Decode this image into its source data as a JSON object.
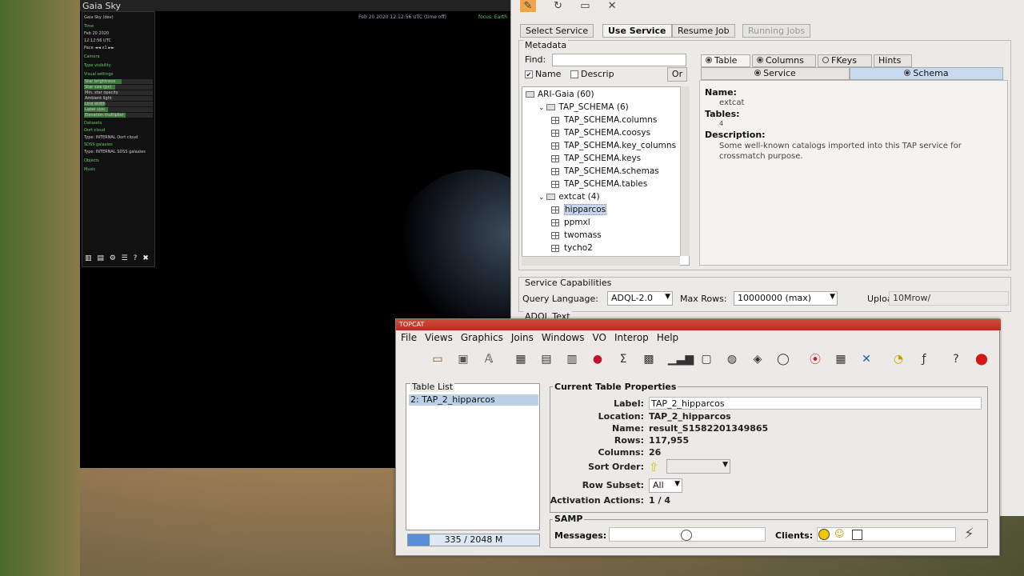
{
  "gaia": {
    "title": "Gaia Sky",
    "clock": "Feb 20 2020 12:12:56 UTC (time off)",
    "focus": "focus: Earth",
    "panel": {
      "header": "Gaia Sky (dev)",
      "time_label": "Time",
      "date": "Feb 20 2020",
      "time": "12:12:56 UTC",
      "pace": "Pace ◄◄ x1 ►►",
      "camera": "Camera",
      "type_visibility": "Type visibility",
      "visual_settings": "Visual settings",
      "sliders": [
        {
          "label": "Star brightness",
          "level": 0.55
        },
        {
          "label": "Star size (px)",
          "level": 0.45
        },
        {
          "label": "Min. star opacity",
          "level": 0.0
        },
        {
          "label": "Ambient light",
          "level": 0.0
        },
        {
          "label": "Line width",
          "level": 0.3
        },
        {
          "label": "Label size",
          "level": 0.35
        },
        {
          "label": "Elevation multiplier",
          "level": 0.6
        }
      ],
      "datasets": "Datasets",
      "ds1_name": "Oort cloud",
      "ds1_info": "Type: INTERNAL  Oort cloud",
      "ds2_name": "SDSS galaxies",
      "ds2_info": "Type: INTERNAL  SDSS galaxies",
      "objects": "Objects",
      "music": "Music"
    }
  },
  "tap": {
    "tabs": [
      "Select Service",
      "Use Service",
      "Resume Job",
      "Running Jobs"
    ],
    "metadata": {
      "legend": "Metadata",
      "find_label": "Find:",
      "name_label": "Name",
      "descrip_label": "Descrip",
      "or_label": "Or",
      "tree": [
        {
          "label": "ARI-Gaia (60)",
          "depth": 0,
          "kind": "root"
        },
        {
          "label": "TAP_SCHEMA (6)",
          "depth": 1,
          "kind": "folder"
        },
        {
          "label": "TAP_SCHEMA.columns",
          "depth": 2,
          "kind": "table"
        },
        {
          "label": "TAP_SCHEMA.coosys",
          "depth": 2,
          "kind": "table"
        },
        {
          "label": "TAP_SCHEMA.key_columns",
          "depth": 2,
          "kind": "table"
        },
        {
          "label": "TAP_SCHEMA.keys",
          "depth": 2,
          "kind": "table"
        },
        {
          "label": "TAP_SCHEMA.schemas",
          "depth": 2,
          "kind": "table"
        },
        {
          "label": "TAP_SCHEMA.tables",
          "depth": 2,
          "kind": "table"
        },
        {
          "label": "extcat (4)",
          "depth": 1,
          "kind": "folder"
        },
        {
          "label": "hipparcos",
          "depth": 2,
          "kind": "table",
          "selected": true
        },
        {
          "label": "ppmxl",
          "depth": 2,
          "kind": "table"
        },
        {
          "label": "twomass",
          "depth": 2,
          "kind": "table"
        },
        {
          "label": "tycho2",
          "depth": 2,
          "kind": "table"
        }
      ],
      "detail_tabs": [
        "Table",
        "Columns",
        "FKeys",
        "Hints"
      ],
      "sub_tabs": [
        "Service",
        "Schema"
      ],
      "name_heading": "Name:",
      "name_value": "extcat",
      "tables_heading": "Tables:",
      "tables_value": "4",
      "desc_heading": "Description:",
      "desc_value": "Some well-known catalogs imported into this TAP service for crossmatch purpose."
    },
    "caps": {
      "legend": "Service Capabilities",
      "query_language_label": "Query Language:",
      "query_language": "ADQL-2.0",
      "max_rows_label": "Max Rows:",
      "max_rows": "10000000 (max)",
      "uploads_label": "Uploads:",
      "uploads": "10Mrow/"
    },
    "adql_legend": "ADQL Text"
  },
  "topcat": {
    "title": "TOPCAT",
    "menu": [
      "File",
      "Views",
      "Graphics",
      "Joins",
      "Windows",
      "VO",
      "Interop",
      "Help"
    ],
    "table_list_title": "Table List",
    "table_item": "2: TAP_2_hipparcos",
    "memory": "335 / 2048 M",
    "memory_fraction": 0.16,
    "props": {
      "title": "Current Table Properties",
      "label_label": "Label:",
      "label_value": "TAP_2_hipparcos",
      "location_label": "Location:",
      "location_value": "TAP_2_hipparcos",
      "name_label": "Name:",
      "name_value": "result_S1582201349865",
      "rows_label": "Rows:",
      "rows_value": "117,955",
      "columns_label": "Columns:",
      "columns_value": "26",
      "sort_label": "Sort Order:",
      "subset_label": "Row Subset:",
      "subset_value": "All",
      "activation_label": "Activation Actions:",
      "activation_value": "1 / 4"
    },
    "samp": {
      "title": "SAMP",
      "messages_label": "Messages:",
      "clients_label": "Clients:"
    }
  }
}
